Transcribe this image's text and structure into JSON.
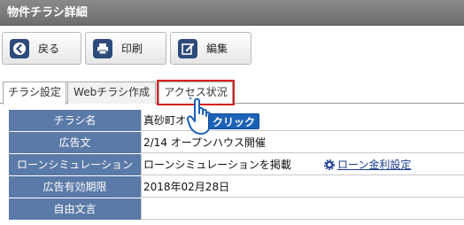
{
  "window": {
    "title": "物件チラシ詳細"
  },
  "toolbar": {
    "back_label": "戻る",
    "print_label": "印刷",
    "edit_label": "編集"
  },
  "tabs": [
    {
      "label": "チラシ設定",
      "state": "active"
    },
    {
      "label": "Webチラシ作成",
      "state": "normal"
    },
    {
      "label": "アクセス状況",
      "state": "highlighted"
    }
  ],
  "details": {
    "rows": [
      {
        "label": "チラシ名",
        "value": "真砂町オ"
      },
      {
        "label": "広告文",
        "value": "2/14 オープンハウス開催"
      },
      {
        "label": "ローンシミュレーション",
        "value": "ローンシミュレーションを掲載",
        "link": "ローン金利設定"
      },
      {
        "label": "広告有効期限",
        "value": "2018年02月28日"
      },
      {
        "label": "自由文言",
        "value": ""
      }
    ]
  },
  "annotation": {
    "click_label": "クリック"
  },
  "colors": {
    "header_bar": "#7b7b7b",
    "row_header": "#5a7aa7",
    "highlight_border": "#d8201f",
    "click_badge": "#1b62b8",
    "link": "#1a3c8c"
  }
}
